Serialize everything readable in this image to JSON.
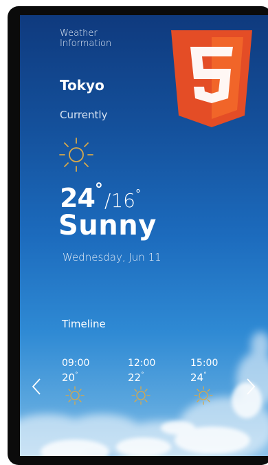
{
  "app": {
    "title": "Weather Information"
  },
  "weather": {
    "city": "Tokyo",
    "currently_label": "Currently",
    "icon": "sun-icon",
    "temp_high": "24",
    "temp_low": "16",
    "degree_symbol": "°",
    "separator": "/",
    "condition": "Sunny",
    "date": "Wednesday, Jun 11"
  },
  "timeline": {
    "label": "Timeline",
    "items": [
      {
        "time": "09:00",
        "temp": "20",
        "icon": "sun-icon"
      },
      {
        "time": "12:00",
        "temp": "22",
        "icon": "sun-icon"
      },
      {
        "time": "15:00",
        "temp": "24",
        "icon": "sun-icon"
      }
    ],
    "prev_icon": "chevron-left-icon",
    "next_icon": "chevron-right-icon"
  },
  "badge": {
    "logo": "html5-logo-icon",
    "digit": "5"
  },
  "colors": {
    "sky_top": "#0f3a7e",
    "sky_bottom": "#8cc2ea",
    "sun_icon": "#d8a94a",
    "badge_orange": "#e44d26",
    "badge_light_orange": "#f16529",
    "device_frame": "#0b0b0b"
  }
}
